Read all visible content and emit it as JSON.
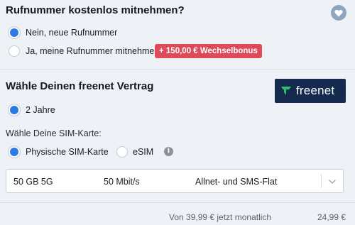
{
  "porting": {
    "title": "Rufnummer kostenlos mitnehmen?",
    "options": [
      {
        "label": "Nein, neue Rufnummer",
        "selected": true
      },
      {
        "label": "Ja, meine Rufnummer mitnehmen",
        "selected": false
      }
    ],
    "bonus_badge": "+ 150,00 € Wechselbonus",
    "favorite_icon": "heart-icon"
  },
  "contract": {
    "title": "Wähle Deinen freenet Vertrag",
    "brand": "freenet",
    "duration_option": {
      "label": "2 Jahre",
      "selected": true
    },
    "sim_heading": "Wähle Deine SIM-Karte:",
    "sim_options": [
      {
        "label": "Physische SIM-Karte",
        "selected": true
      },
      {
        "label": "eSIM",
        "selected": false
      }
    ],
    "info_icon": "i"
  },
  "tariff": {
    "data_volume": "50 GB 5G",
    "speed": "50 Mbit/s",
    "flat": "Allnet- und SMS-Flat"
  },
  "price": {
    "old_text": "Von 39,99 € jetzt monatlich",
    "new_price": "24,99 €"
  },
  "colors": {
    "accent": "#2c7be5",
    "badge": "#df4a5a",
    "logo_bg": "#142a4e",
    "logo_green": "#2fbf71",
    "background": "#eef1f6"
  }
}
